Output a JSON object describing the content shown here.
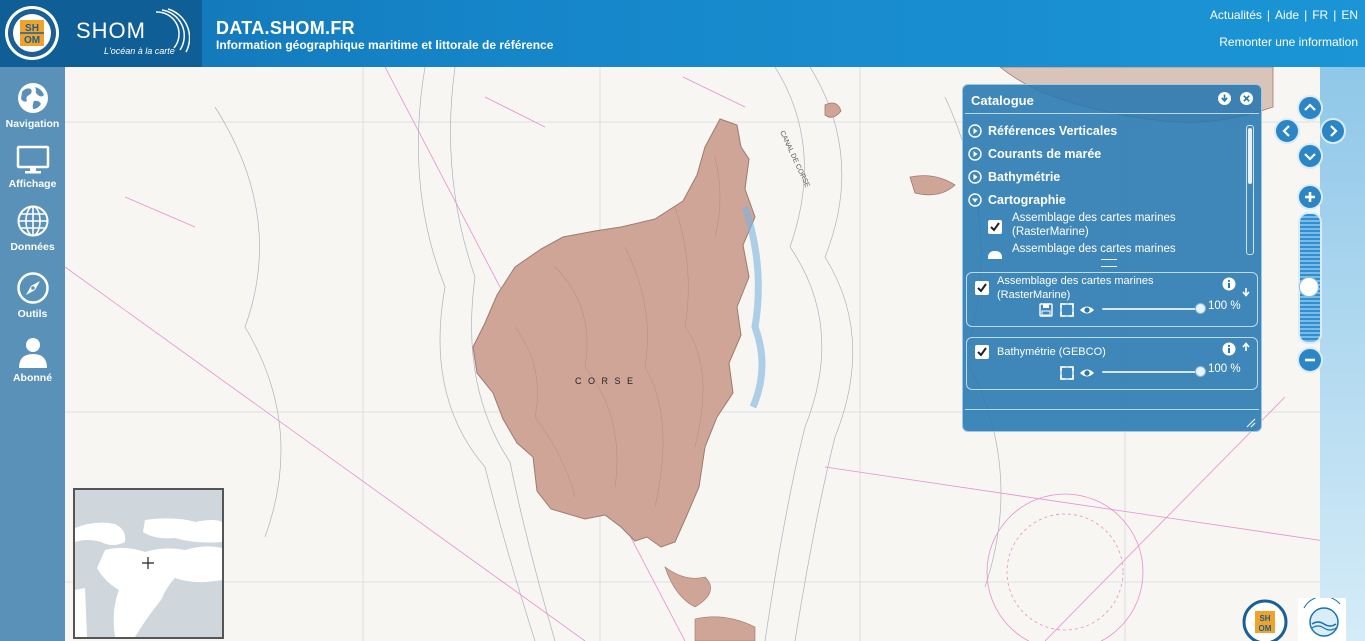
{
  "header": {
    "logo_text": "SHOM",
    "logo_tagline": "L'océan à la carte",
    "seal_top": "SH",
    "seal_bottom": "OM",
    "site_title": "DATA.SHOM.FR",
    "site_subtitle": "Information géographique maritime et littorale de référence",
    "links": [
      "Actualités",
      "Aide",
      "FR",
      "EN"
    ],
    "report_link": "Remonter une information"
  },
  "sidebar": {
    "items": [
      {
        "label": "Navigation",
        "icon": "globe-icon"
      },
      {
        "label": "Affichage",
        "icon": "monitor-icon"
      },
      {
        "label": "Données",
        "icon": "grid-globe-icon"
      },
      {
        "label": "Outils",
        "icon": "compass-icon"
      },
      {
        "label": "Abonné",
        "icon": "user-icon"
      }
    ]
  },
  "map": {
    "island_label": "C O R S E",
    "strait_label": "CANAL DE CORSE"
  },
  "catalog": {
    "title": "Catalogue",
    "categories": [
      {
        "label": "Références Verticales",
        "expanded": false
      },
      {
        "label": "Courants de marée",
        "expanded": false
      },
      {
        "label": "Bathymétrie",
        "expanded": false
      },
      {
        "label": "Cartographie",
        "expanded": true
      }
    ],
    "cartographie_items": [
      {
        "line1": "Assemblage des cartes marines",
        "line2": "(RasterMarine)",
        "checked": true
      },
      {
        "line1": "Assemblage des cartes marines",
        "checked": false
      }
    ],
    "active_layers": [
      {
        "line1": "Assemblage des cartes marines",
        "line2": "(RasterMarine)",
        "opacity_text": "100 %",
        "opacity": 1.0,
        "checked": true
      },
      {
        "line1": "Bathymétrie (GEBCO)",
        "opacity_text": "100 %",
        "opacity": 1.0,
        "checked": true
      }
    ]
  },
  "colors": {
    "header_blue": "#1585c8",
    "sidebar_blue": "#5a91b8",
    "panel_blue": "#2678af",
    "land": "#cfa597",
    "sea_lines": "#9aa7b4",
    "pink_lines": "#e98fd0"
  }
}
